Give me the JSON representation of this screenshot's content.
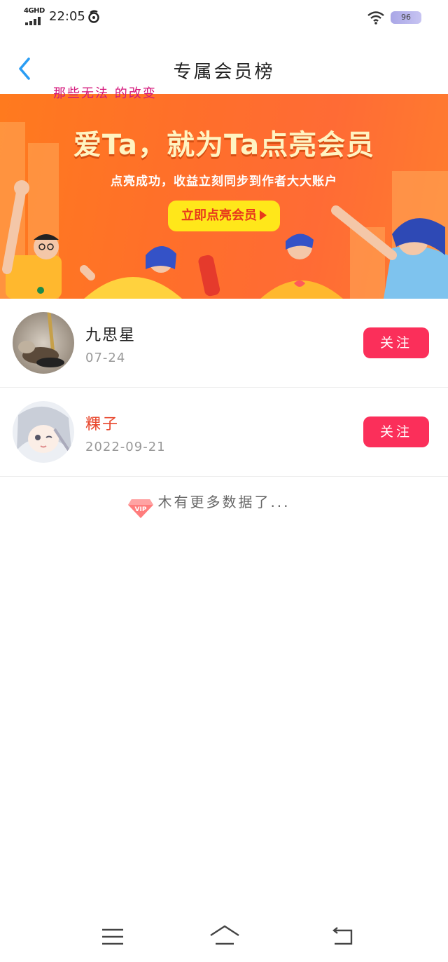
{
  "status_bar": {
    "network": "4GHD",
    "time": "22:05",
    "battery": "96"
  },
  "header": {
    "title": "专属会员榜",
    "overlay_text": "那些无法 的改变"
  },
  "banner": {
    "headline": "爱Ta，就为Ta点亮会员",
    "subtitle": "点亮成功，收益立刻同步到作者大大账户",
    "cta": "立即点亮会员"
  },
  "members": [
    {
      "name": "九思星",
      "date": "07-24",
      "vip": false,
      "follow_label": "关注"
    },
    {
      "name": "粿子",
      "date": "2022-09-21",
      "vip": true,
      "vip_label": "VIP",
      "follow_label": "关注"
    }
  ],
  "list_end_text": "木有更多数据了...",
  "icons": {
    "back": "chevron-left-icon",
    "wifi": "wifi-icon",
    "vip": "diamond-vip-icon",
    "menu": "menu-icon",
    "home": "home-icon",
    "return": "return-icon"
  },
  "colors": {
    "accent_blue": "#2a9df4",
    "follow_button": "#fb2f5a",
    "banner_orange": "#ff6f2a",
    "cta_yellow": "#ffe71a",
    "vip_name": "#e8462c"
  }
}
